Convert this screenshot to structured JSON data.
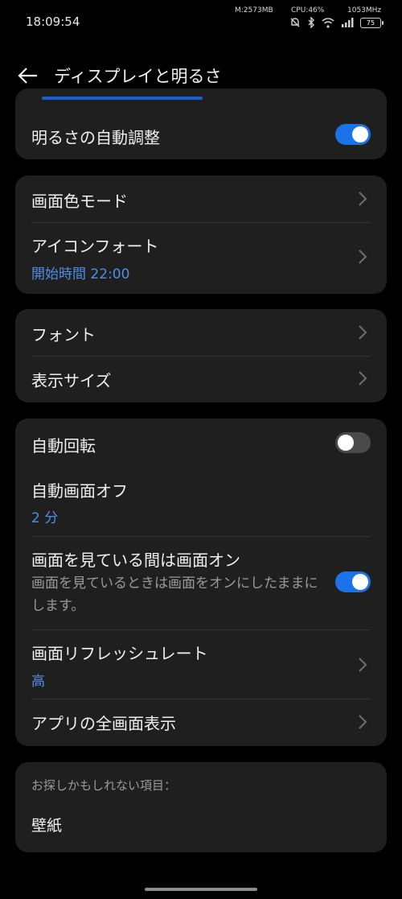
{
  "status_bar": {
    "time": "18:09:54",
    "memory": "M:2573MB",
    "cpu": "CPU:46%",
    "freq": "1053MHz",
    "battery": "75"
  },
  "header": {
    "title": "ディスプレイと明るさ"
  },
  "brightness": {
    "auto_label": "明るさの自動調整",
    "auto_on": true
  },
  "color_group": {
    "color_mode_label": "画面色モード",
    "eye_comfort_label": "アイコンフォート",
    "eye_comfort_value": "開始時間 22:00"
  },
  "font_group": {
    "font_label": "フォント",
    "display_size_label": "表示サイズ"
  },
  "screen_group": {
    "auto_rotate_label": "自動回転",
    "auto_rotate_on": false,
    "sleep_label": "自動画面オフ",
    "sleep_value": "2 分",
    "stay_awake_label": "画面を見ている間は画面オン",
    "stay_awake_desc": "画面を見ているときは画面をオンにしたままにします。",
    "stay_awake_on": true,
    "refresh_label": "画面リフレッシュレート",
    "refresh_value": "高",
    "fullscreen_label": "アプリの全画面表示"
  },
  "suggestions": {
    "title": "お探しかもしれない項目：",
    "items": [
      "壁紙"
    ]
  }
}
